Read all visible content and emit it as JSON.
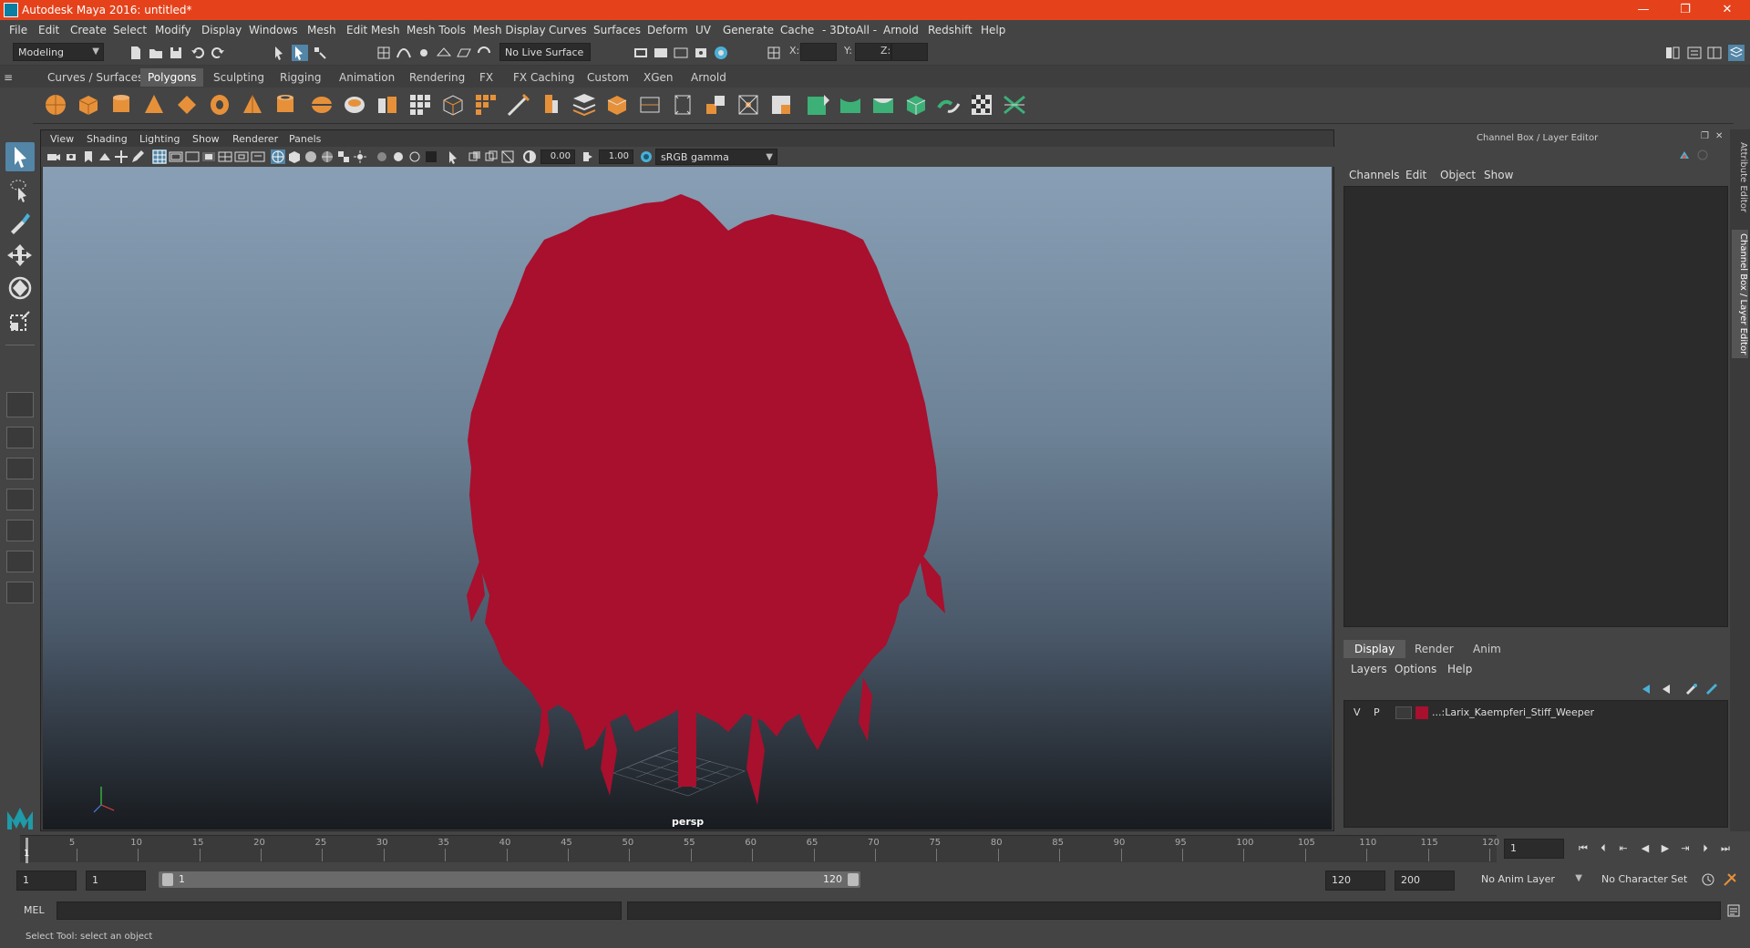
{
  "window": {
    "title": "Autodesk Maya 2016: untitled*",
    "accent_color": "#e5421b",
    "controls": [
      "—",
      "❐",
      "✕"
    ]
  },
  "menubar": {
    "items": [
      "File",
      "Edit",
      "Create",
      "Select",
      "Modify",
      "Display",
      "Windows",
      "Mesh",
      "Edit Mesh",
      "Mesh Tools",
      "Mesh Display",
      "Curves",
      "Surfaces",
      "Deform",
      "UV",
      "Generate",
      "Cache",
      "- 3DtoAll -",
      "Arnold",
      "Redshift",
      "Help"
    ]
  },
  "statusline": {
    "mode": "Modeling",
    "live_surface": "No Live Surface",
    "x_label": "X:",
    "y_label": "Y:",
    "z_label": "Z:"
  },
  "shelf": {
    "tabs": [
      "Curves / Surfaces",
      "Polygons",
      "Sculpting",
      "Rigging",
      "Animation",
      "Rendering",
      "FX",
      "FX Caching",
      "Custom",
      "XGen",
      "Arnold"
    ],
    "active_tab": "Polygons"
  },
  "panel": {
    "menus": [
      "View",
      "Shading",
      "Lighting",
      "Show",
      "Renderer",
      "Panels"
    ],
    "exposure": "0.00",
    "gamma": "1.00",
    "color_space": "sRGB gamma",
    "camera": "persp",
    "model_color": "#a8102e"
  },
  "right_panel": {
    "title": "Channel Box / Layer Editor",
    "menus": [
      "Channels",
      "Edit",
      "Object",
      "Show"
    ],
    "layer_tabs": [
      "Display",
      "Render",
      "Anim"
    ],
    "active_layer_tab": "Display",
    "layer_menus": [
      "Layers",
      "Options",
      "Help"
    ],
    "layers": [
      {
        "visible": "V",
        "playback": "P",
        "name": "...:Larix_Kaempferi_Stiff_Weeper",
        "color": "#a8102e"
      }
    ],
    "side_tabs": [
      "Attribute Editor",
      "Channel Box / Layer Editor"
    ]
  },
  "timeline": {
    "ticks": [
      "5",
      "10",
      "15",
      "20",
      "25",
      "30",
      "35",
      "40",
      "45",
      "50",
      "55",
      "60",
      "65",
      "70",
      "75",
      "80",
      "85",
      "90",
      "95",
      "100",
      "105",
      "110",
      "115",
      "120"
    ],
    "current_frame": "1",
    "current_frame_field": "1",
    "start": 1,
    "end": 120
  },
  "range": {
    "start_field": "1",
    "start_field2": "1",
    "range_start_label": "1",
    "range_end_label": "120",
    "end_field": "120",
    "end_field2": "200",
    "anim_layer": "No Anim Layer",
    "character_set": "No Character Set"
  },
  "cmdline": {
    "label": "MEL"
  },
  "helpline": {
    "text": "Select Tool: select an object"
  }
}
